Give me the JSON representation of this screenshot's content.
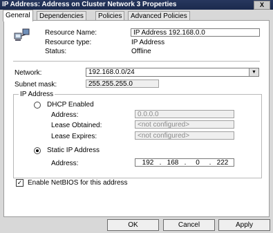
{
  "window": {
    "title": "IP Address: Address on Cluster Network 3 Properties",
    "close_glyph": "X"
  },
  "tabs": [
    {
      "label": "General"
    },
    {
      "label": "Dependencies"
    },
    {
      "label": "Policies"
    },
    {
      "label": "Advanced Policies"
    }
  ],
  "resource": {
    "name_label": "Resource Name:",
    "name_value": "IP Address 192.168.0.0",
    "type_label": "Resource type:",
    "type_value": "IP Address",
    "status_label": "Status:",
    "status_value": "Offline",
    "icon": "network-resource-icon"
  },
  "network": {
    "network_label": "Network:",
    "network_value": "192.168.0.0/24",
    "subnet_label": "Subnet mask:",
    "subnet_value": "255.255.255.0"
  },
  "ip_address": {
    "group_label": "IP Address",
    "dhcp_label": "DHCP Enabled",
    "dhcp_address_label": "Address:",
    "dhcp_address_value": "0.0.0.0",
    "lease_obtained_label": "Lease Obtained:",
    "lease_obtained_value": "<not configured>",
    "lease_expires_label": "Lease Expires:",
    "lease_expires_value": "<not configured>",
    "static_label": "Static IP Address",
    "static_address_label": "Address:",
    "static_octets": [
      "192",
      "168",
      "0",
      "222"
    ],
    "selected_mode": "static"
  },
  "netbios": {
    "label": "Enable NetBIOS for this address",
    "checked": true
  },
  "buttons": {
    "ok": "OK",
    "cancel": "Cancel",
    "apply": "Apply"
  }
}
